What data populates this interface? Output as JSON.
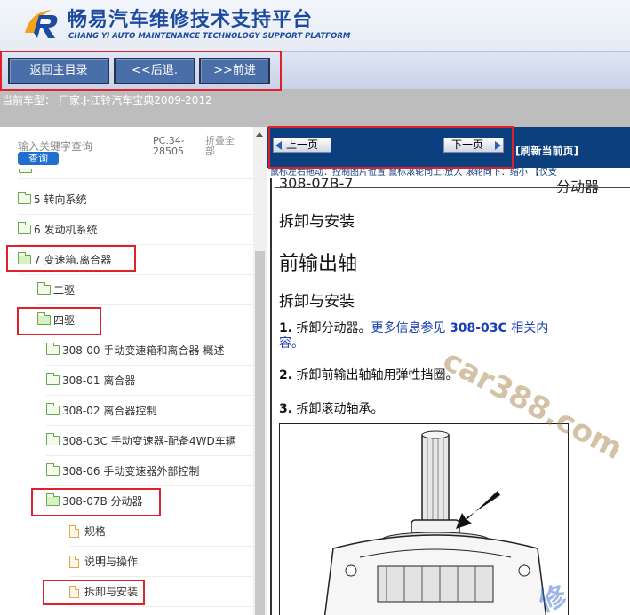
{
  "header": {
    "title": "畅易汽车维修技术支持平台",
    "subtitle": "CHANG YI AUTO MAINTENANCE TECHNOLOGY SUPPORT PLATFORM",
    "logo_icon": "r-swoosh-logo"
  },
  "toolbar": {
    "back_label": "返回主目录",
    "prev_label": "<<后退.",
    "next_label": ">>前进"
  },
  "model_bar": {
    "text": "当前车型： 厂家:J-江铃汽车宝典2009-2012"
  },
  "sidebar": {
    "search_placeholder": "输入关键字查询",
    "search_button": "查询",
    "pc_code": "PC.34-28505",
    "collapse_label": "折叠全部",
    "items": [
      {
        "label": "5 转向系统",
        "icon": "folder-icon"
      },
      {
        "label": "6 发动机系统",
        "icon": "folder-icon"
      },
      {
        "label": "7 变速箱.离合器",
        "icon": "folder-open-icon"
      },
      {
        "label": "二驱",
        "icon": "folder-icon"
      },
      {
        "label": "四驱",
        "icon": "folder-open-icon"
      },
      {
        "label": "308-00 手动变速箱和离合器-概述",
        "icon": "folder-icon"
      },
      {
        "label": "308-01 离合器",
        "icon": "folder-icon"
      },
      {
        "label": "308-02 离合器控制",
        "icon": "folder-icon"
      },
      {
        "label": "308-03C 手动变速器-配备4WD车辆",
        "icon": "folder-icon"
      },
      {
        "label": "308-06 手动变速器外部控制",
        "icon": "folder-icon"
      },
      {
        "label": "308-07B 分动器",
        "icon": "folder-open-icon"
      },
      {
        "label": "规格",
        "icon": "document-icon"
      },
      {
        "label": "说明与操作",
        "icon": "document-icon"
      },
      {
        "label": "拆卸与安装",
        "icon": "document-icon"
      }
    ]
  },
  "viewer": {
    "prev_page": "上一页",
    "next_page": "下一页",
    "refresh": "[刷新当前页]",
    "hint": "鼠标左右拖动：控制图片位置 鼠标滚轮向上:放大  滚轮向下：缩小 【仅支"
  },
  "document": {
    "code": "308-07B-7",
    "section": "分动器",
    "heading1": "拆卸与安装",
    "heading2": "前输出轴",
    "heading3": "拆卸与安装",
    "steps": [
      {
        "num": "1.",
        "text": "拆卸分动器。",
        "link_pre": "更多信息参见 ",
        "link_bold": "308-03C",
        "link_post": " 相关内容。"
      },
      {
        "num": "2.",
        "text": "拆卸前输出轴轴用弹性挡圈。"
      },
      {
        "num": "3.",
        "text": "拆卸滚动轴承。"
      }
    ]
  },
  "watermarks": {
    "primary": "car388.com",
    "secondary": "修"
  },
  "colors": {
    "brand_blue": "#1b4aa0",
    "toolbar_button": "#4a6ea8",
    "nav_bar": "#0b3f7d",
    "highlight_red": "#e0202a",
    "link_blue": "#1a3fb0"
  }
}
